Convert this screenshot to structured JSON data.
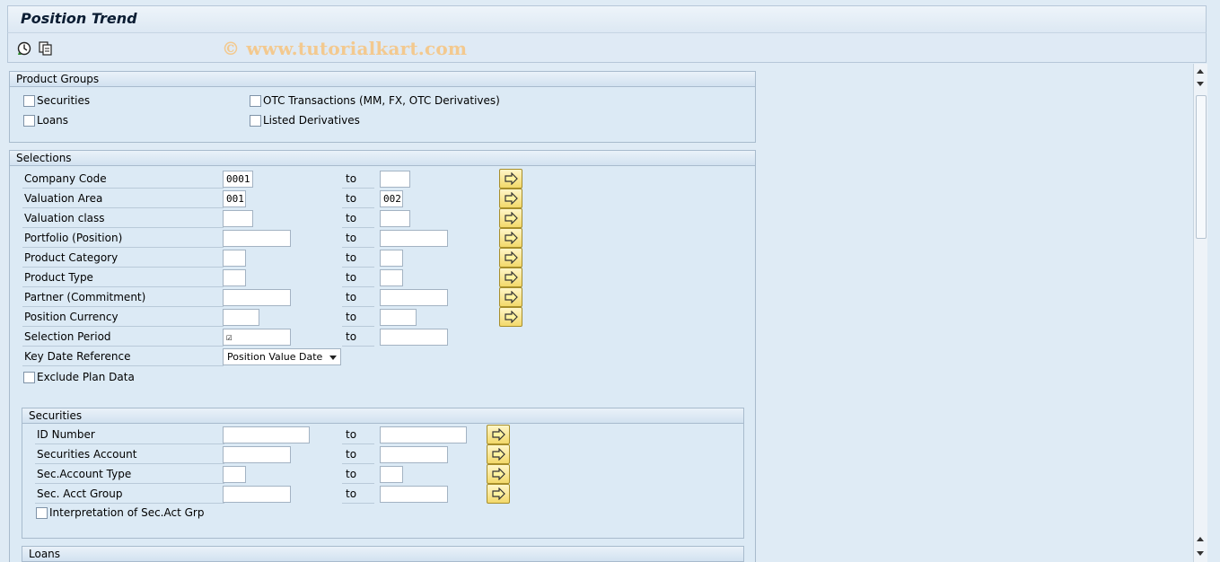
{
  "window": {
    "title": "Position Trend"
  },
  "toolbar": {
    "execute_icon": "execute-clock-icon",
    "variant_icon": "get-variant-icon",
    "watermark": "© www.tutorialkart.com"
  },
  "product_groups": {
    "header": "Product Groups",
    "securities": "Securities",
    "loans": "Loans",
    "otc": "OTC Transactions (MM, FX, OTC Derivatives)",
    "listed": "Listed Derivatives"
  },
  "selections": {
    "header": "Selections",
    "to_label": "to",
    "rows": [
      {
        "label": "Company Code",
        "from": "0001",
        "to": ""
      },
      {
        "label": "Valuation Area",
        "from": "001",
        "to": "002"
      },
      {
        "label": "Valuation class",
        "from": "",
        "to": ""
      },
      {
        "label": "Portfolio (Position)",
        "from": "",
        "to": ""
      },
      {
        "label": "Product Category",
        "from": "",
        "to": ""
      },
      {
        "label": "Product Type",
        "from": "",
        "to": ""
      },
      {
        "label": "Partner (Commitment)",
        "from": "",
        "to": ""
      },
      {
        "label": "Position Currency",
        "from": "",
        "to": ""
      },
      {
        "label": "Selection Period",
        "from": "☑",
        "to": ""
      }
    ],
    "key_date_label": "Key Date Reference",
    "key_date_value": "Position Value Date",
    "exclude_plan": "Exclude Plan Data"
  },
  "securities": {
    "header": "Securities",
    "rows": [
      {
        "label": "ID Number",
        "from": "",
        "to": ""
      },
      {
        "label": "Securities Account",
        "from": "",
        "to": ""
      },
      {
        "label": "Sec.Account Type",
        "from": "",
        "to": ""
      },
      {
        "label": "Sec. Acct Group",
        "from": "",
        "to": ""
      }
    ],
    "interpretation": "Interpretation of Sec.Act Grp"
  },
  "loans": {
    "header": "Loans"
  },
  "colors": {
    "accent": "#f3d96a",
    "panel": "#dceaf5",
    "border": "#a8bbcd"
  }
}
